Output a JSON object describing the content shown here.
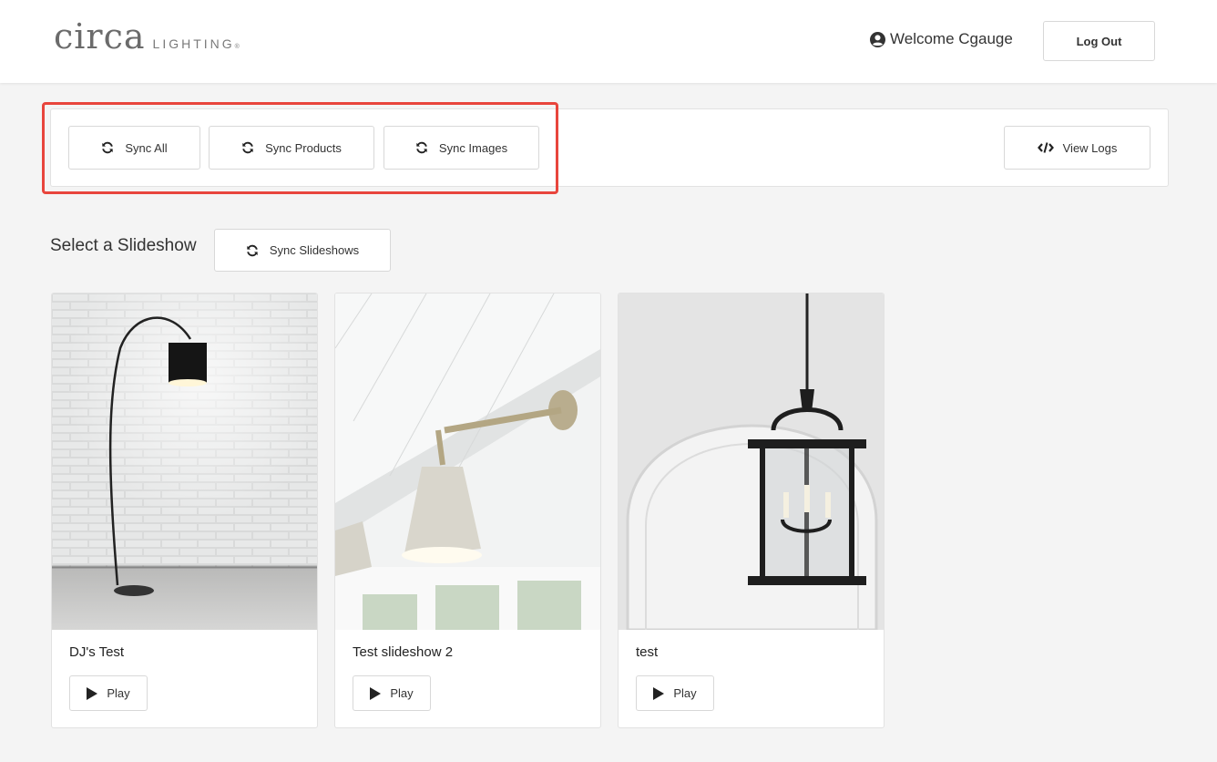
{
  "header": {
    "logo_main": "circa",
    "logo_sub": "LIGHTING",
    "logo_mark": "®",
    "welcome_text": "Welcome Cgauge",
    "logout_label": "Log Out"
  },
  "toolbar": {
    "sync_all_label": "Sync All",
    "sync_products_label": "Sync Products",
    "sync_images_label": "Sync Images",
    "view_logs_label": "View Logs"
  },
  "slideshows": {
    "title": "Select a Slideshow",
    "sync_label": "Sync Slideshows",
    "play_label": "Play",
    "items": [
      {
        "name": "DJ's Test"
      },
      {
        "name": "Test slideshow 2"
      },
      {
        "name": "test"
      }
    ]
  },
  "colors": {
    "highlight": "#e8453c",
    "background": "#f4f4f4"
  }
}
